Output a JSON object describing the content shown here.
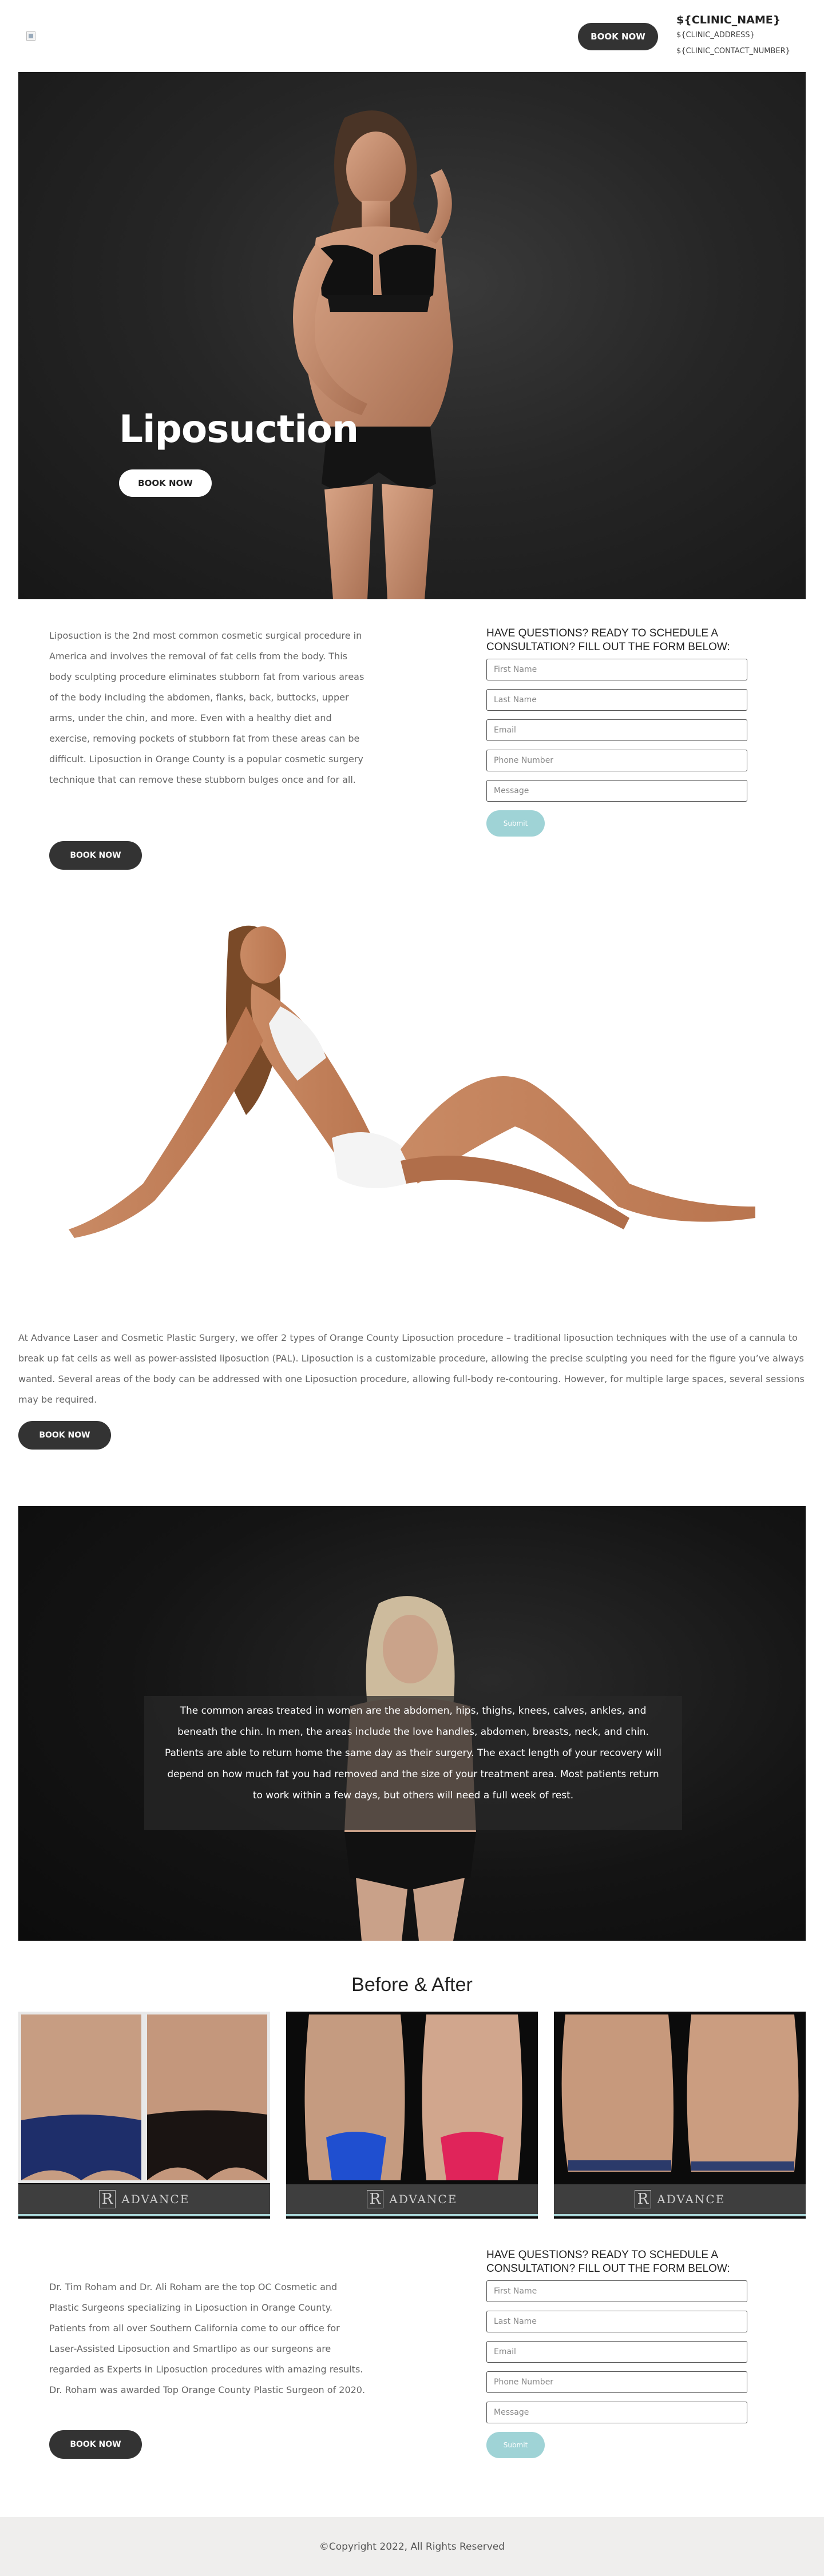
{
  "header": {
    "book_label": "BOOK NOW",
    "clinic_name": "${CLINIC_NAME}",
    "clinic_address": "${CLINIC_ADDRESS}",
    "clinic_contact": "${CLINIC_CONTACT_NUMBER}"
  },
  "hero": {
    "title": "Liposuction",
    "book_label": "BOOK NOW"
  },
  "intro": {
    "text": "Liposuction is the 2nd most common cosmetic surgical procedure in America and involves the removal of fat cells from the body. This body sculpting procedure eliminates stubborn fat from various areas of the body including the abdomen, flanks, back, buttocks, upper arms, under the chin, and more. Even with a healthy diet and exercise, removing pockets of stubborn fat from these areas can be difficult. Liposuction in Orange County is a popular cosmetic surgery technique that can remove these stubborn bulges once and for all.",
    "book_label": "BOOK NOW"
  },
  "form_top": {
    "heading": "HAVE QUESTIONS? READY TO SCHEDULE A CONSULTATION? FILL OUT THE FORM BELOW:",
    "first_name": "First Name",
    "last_name": "Last Name",
    "email": "Email",
    "phone": "Phone Number",
    "message": "Message",
    "submit": "Submit"
  },
  "types": {
    "text": "At Advance Laser and Cosmetic Plastic Surgery, we offer 2 types of Orange County Liposuction procedure – traditional liposuction techniques with the use of a cannula to break up fat cells as well as power-assisted liposuction (PAL). Liposuction is a customizable procedure, allowing the precise sculpting you need for the figure you’ve always wanted. Several areas of the body can be addressed with one Liposuction procedure, allowing full-body re-contouring. However, for multiple large spaces, several sessions may be required.",
    "book_label": "BOOK NOW"
  },
  "areas": {
    "text": "The common areas treated in women are the abdomen, hips, thighs, knees, calves, ankles, and beneath the chin. In men, the areas include the love handles, abdomen, breasts, neck, and chin. Patients are able to return home the same day as their surgery. The exact length of your recovery will depend on how much fat you had removed and the size of your treatment area. Most patients return to work within a few days, but others will need a full week of rest."
  },
  "before_after": {
    "title": "Before & After",
    "brand": "ADVANCE",
    "brand_mark": "R"
  },
  "bottom": {
    "text": "Dr. Tim Roham and Dr. Ali Roham are the top OC Cosmetic and Plastic Surgeons specializing in Liposuction in Orange County. Patients from all over Southern California come to our office for Laser-Assisted Liposuction and Smartlipo as our surgeons are regarded as Experts in Liposuction procedures with amazing results. Dr. Roham was awarded Top Orange County Plastic Surgeon of 2020.",
    "book_label": "BOOK NOW"
  },
  "form_bottom": {
    "heading": "HAVE QUESTIONS? READY TO SCHEDULE A CONSULTATION? FILL OUT THE FORM BELOW:",
    "first_name": "First Name",
    "last_name": "Last Name",
    "email": "Email",
    "phone": "Phone Number",
    "message": "Message",
    "submit": "Submit"
  },
  "footer": {
    "copyright": "©Copyright 2022, All Rights Reserved"
  },
  "colors": {
    "dark_button": "#333333",
    "submit_button": "#9fd3d6",
    "footer_bg": "#efeeed"
  }
}
